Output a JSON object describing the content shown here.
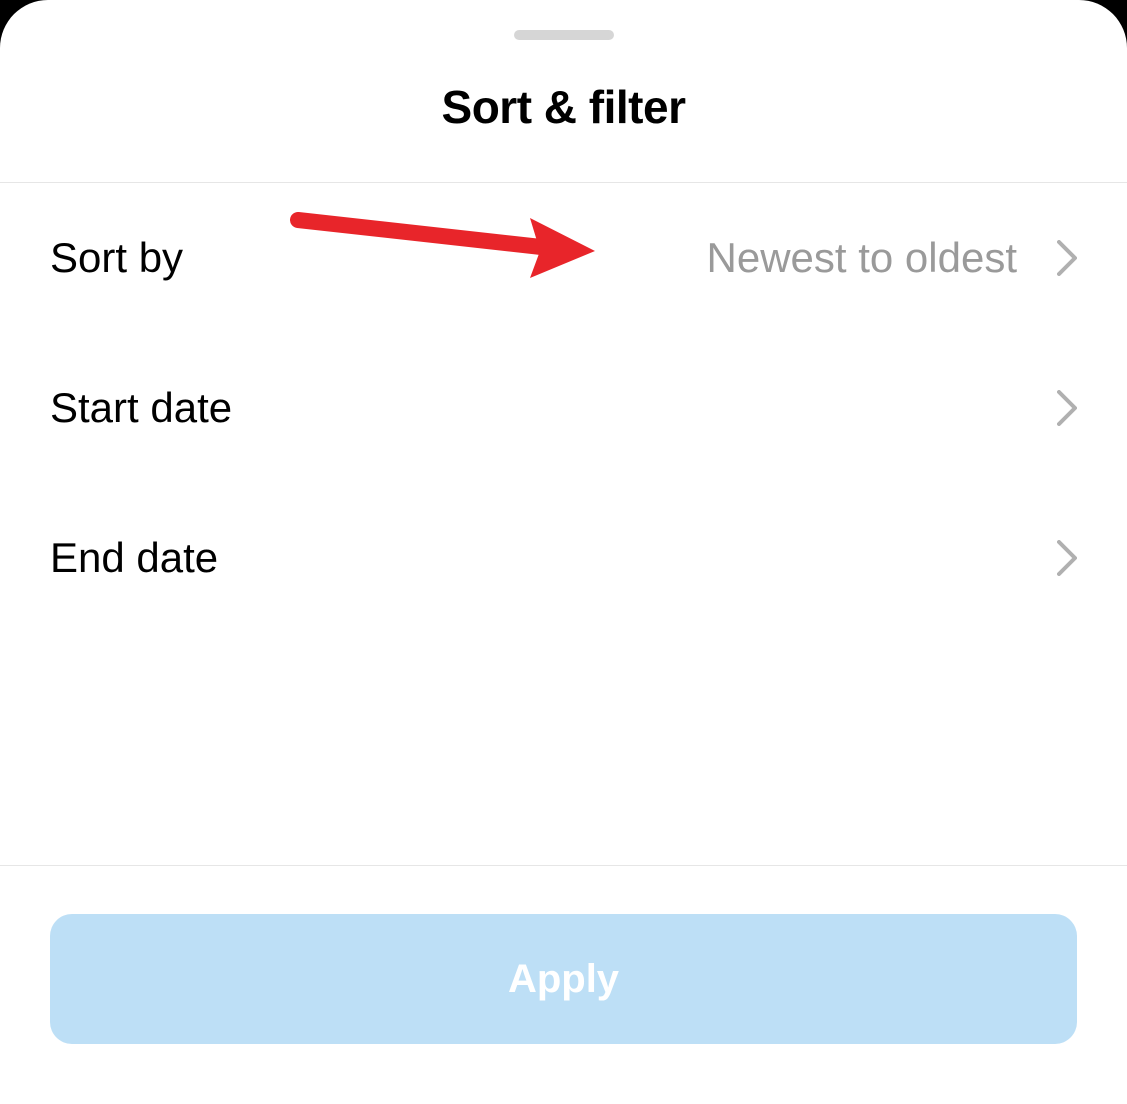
{
  "header": {
    "title": "Sort & filter"
  },
  "rows": {
    "sortBy": {
      "label": "Sort by",
      "value": "Newest to oldest"
    },
    "startDate": {
      "label": "Start date",
      "value": ""
    },
    "endDate": {
      "label": "End date",
      "value": ""
    }
  },
  "footer": {
    "applyLabel": "Apply"
  },
  "colors": {
    "applyBackground": "#bddff6",
    "valueText": "#9a9a9a",
    "divider": "#e6e6e6",
    "annotationArrow": "#e8252a"
  }
}
